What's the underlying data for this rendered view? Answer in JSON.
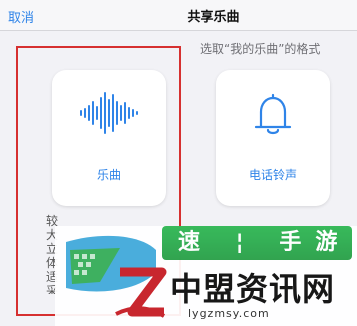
{
  "navbar": {
    "cancel_label": "取消",
    "title": "共享乐曲"
  },
  "main": {
    "subtitle": "选取“我的乐曲”的格式",
    "options": [
      {
        "label": "乐曲",
        "icon": "waveform-icon"
      },
      {
        "label": "电话铃声",
        "icon": "bell-icon"
      }
    ],
    "partial_text_left": "较大\n立体\n适\n采\n表",
    "partial_text_right": ""
  },
  "watermark": {
    "top_text": "速 ¦ 手游",
    "brand": "中盟资讯网",
    "domain": "lygzmsy.com"
  },
  "colors": {
    "accent": "#2f84e8",
    "highlight": "#d63030",
    "watermark_green": "#23b34a"
  }
}
